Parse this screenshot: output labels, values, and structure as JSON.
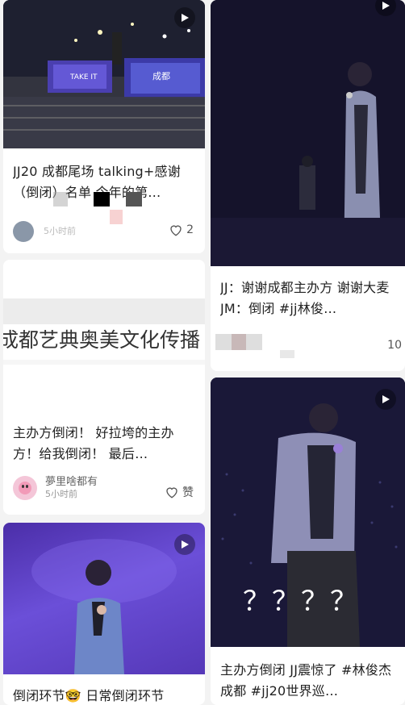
{
  "cards": [
    {
      "title": "JJ20 成都尾场 talking+感谢（倒闭）名单 今年的第…",
      "time": "5小时前",
      "likes": "2",
      "icon": "play-icon"
    },
    {
      "title": "JJ：谢谢成都主办方 谢谢大麦 JM：倒闭 #jj林俊…",
      "likes": "10",
      "icon": "play-icon"
    },
    {
      "banner_text": "成都艺典奥美文化传播",
      "title": "主办方倒闭！ 好拉垮的主办方！给我倒闭！ 最后…",
      "username": "夢里啥都有",
      "time": "5小时前",
      "likes": "赞"
    },
    {
      "overlay_text": "？？？？",
      "title": "主办方倒闭 JJ震惊了 #林俊杰成都 #jj20世界巡…",
      "icon": "play-icon"
    },
    {
      "title": "倒闭环节🤓 日常倒闭环节",
      "icon": "play-icon"
    }
  ],
  "colors": {
    "stage_dark": "#14122a",
    "stage_purple": "#3a2a7a",
    "video_purple": "#6a4fd0",
    "card_bg": "#ffffff",
    "page_bg": "#f3f3f3"
  }
}
